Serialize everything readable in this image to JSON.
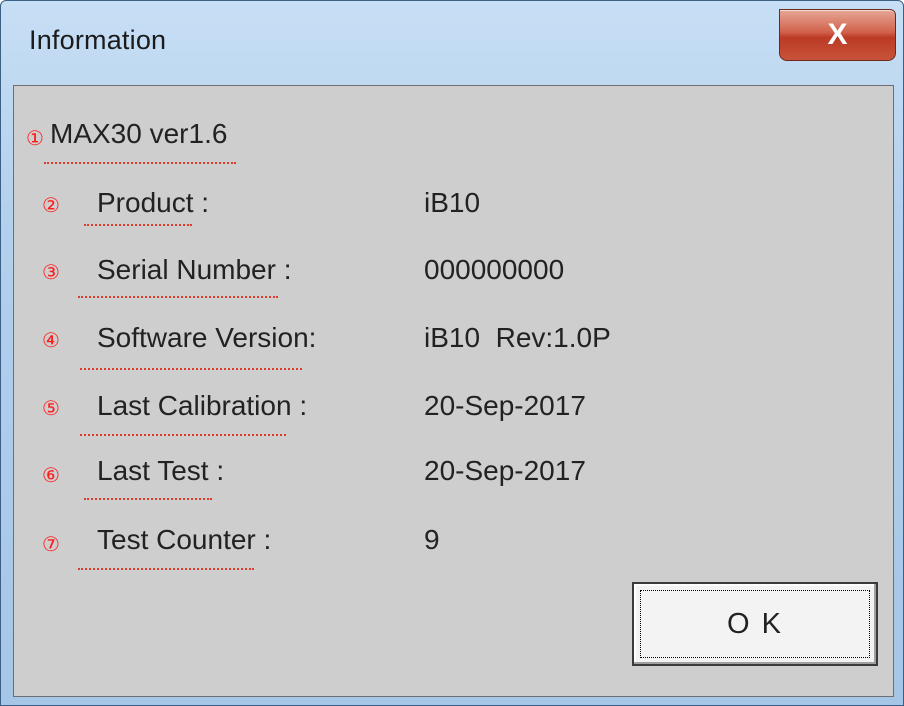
{
  "window": {
    "title": "Information",
    "close_label": "X"
  },
  "header": {
    "marker": "①",
    "model": "MAX30 ver1.6"
  },
  "rows": [
    {
      "marker": "②",
      "label": "Product :",
      "value": "iB10"
    },
    {
      "marker": "③",
      "label": "Serial Number :",
      "value": "000000000"
    },
    {
      "marker": "④",
      "label": "Software Version:",
      "value": "iB10  Rev:1.0P"
    },
    {
      "marker": "⑤",
      "label": "Last Calibration :",
      "value": "20-Sep-2017"
    },
    {
      "marker": "⑥",
      "label": "Last Test :",
      "value": "20-Sep-2017"
    },
    {
      "marker": "⑦",
      "label": "Test Counter :",
      "value": "9"
    }
  ],
  "ok_button": {
    "label": "O K"
  },
  "colors": {
    "annotation": "#ff1a1a",
    "dialog_bg": "#cecece",
    "titlebar": "#b3d0ed",
    "close_button": "#c9533a"
  }
}
